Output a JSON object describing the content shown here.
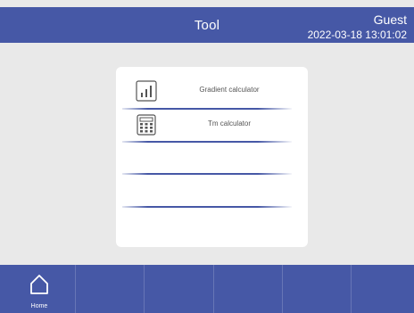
{
  "header": {
    "title": "Tool",
    "user": "Guest",
    "datetime": "2022-03-18 13:01:02"
  },
  "tools": [
    {
      "label": "Gradient calculator",
      "icon": "bar-chart-icon"
    },
    {
      "label": "Tm calculator",
      "icon": "calculator-icon"
    }
  ],
  "footer": {
    "home_label": "Home"
  },
  "colors": {
    "accent": "#4658a6",
    "background": "#e9e9e9",
    "card": "#ffffff"
  }
}
